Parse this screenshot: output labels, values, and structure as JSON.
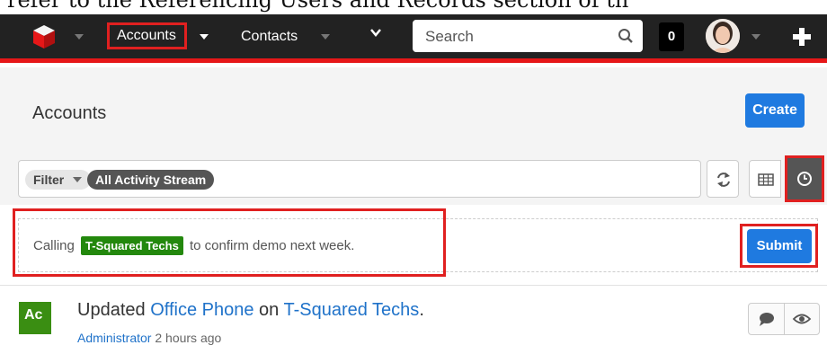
{
  "doc_text": "refer to the Referencing Users and Records section of th",
  "navbar": {
    "modules": [
      {
        "label": "Accounts"
      },
      {
        "label": "Contacts"
      }
    ],
    "search_placeholder": "Search",
    "notification_count": "0"
  },
  "header": {
    "title": "Accounts",
    "create_label": "Create"
  },
  "filter": {
    "label": "Filter",
    "active_filter": "All Activity Stream"
  },
  "comment": {
    "before": "Calling",
    "tag": "T-Squared Techs",
    "after": "to confirm demo next week.",
    "submit_label": "Submit"
  },
  "activity": {
    "badge": "Ac",
    "verb": "Updated",
    "field": "Office Phone",
    "preposition": "on",
    "record": "T-Squared Techs",
    "user": "Administrator",
    "time": "2 hours ago"
  },
  "colors": {
    "navbar": "#222222",
    "accent_red": "#e61718",
    "primary_blue": "#1f7ae0",
    "tag_green": "#23880d"
  }
}
